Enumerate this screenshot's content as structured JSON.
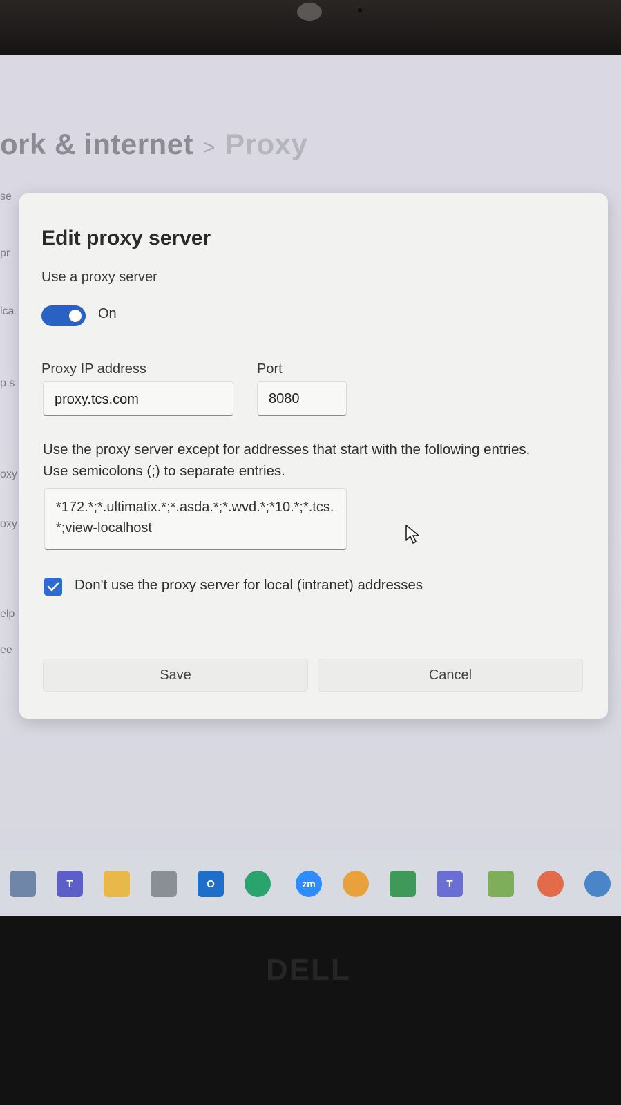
{
  "background": {
    "breadcrumb_parent": "ork & internet",
    "breadcrumb_separator": ">",
    "breadcrumb_current": "Proxy",
    "edge_fragments": [
      "se",
      "pr",
      "ica",
      "p s",
      "oxy",
      "oxy",
      "elp",
      "ee"
    ]
  },
  "dialog": {
    "title": "Edit proxy server",
    "use_proxy_label": "Use a proxy server",
    "toggle_state": "On",
    "ip_label": "Proxy IP address",
    "ip_value": "proxy.tcs.com",
    "port_label": "Port",
    "port_value": "8080",
    "exceptions_line1": "Use the proxy server except for addresses that start with the following entries.",
    "exceptions_line2": "Use semicolons (;) to separate entries.",
    "exceptions_value": "*172.*;*.ultimatix.*;*.asda.*;*.wvd.*;*10.*;*.tcs.*;view-localhost",
    "local_bypass_label": "Don't use the proxy server for local (intranet) addresses",
    "local_bypass_checked": true,
    "save_label": "Save",
    "cancel_label": "Cancel"
  },
  "colors": {
    "accent": "#2a62c4",
    "dialog_bg": "#f2f2f0"
  },
  "taskbar": {
    "icons": [
      {
        "name": "file-explorer-icon",
        "text": ""
      },
      {
        "name": "teams-icon",
        "text": "T"
      },
      {
        "name": "folder-icon",
        "text": ""
      },
      {
        "name": "calculator-icon",
        "text": ""
      },
      {
        "name": "outlook-icon",
        "text": "O"
      },
      {
        "name": "edge-icon",
        "text": ""
      },
      {
        "name": "zoom-icon",
        "text": "zm"
      },
      {
        "name": "chrome-icon",
        "text": ""
      },
      {
        "name": "chat-icon",
        "text": ""
      },
      {
        "name": "teams-work-icon",
        "text": "T"
      },
      {
        "name": "remote-desktop-icon",
        "text": ""
      },
      {
        "name": "vpn-icon",
        "text": ""
      },
      {
        "name": "settings-icon",
        "text": ""
      }
    ]
  },
  "device_brand": "DELL"
}
